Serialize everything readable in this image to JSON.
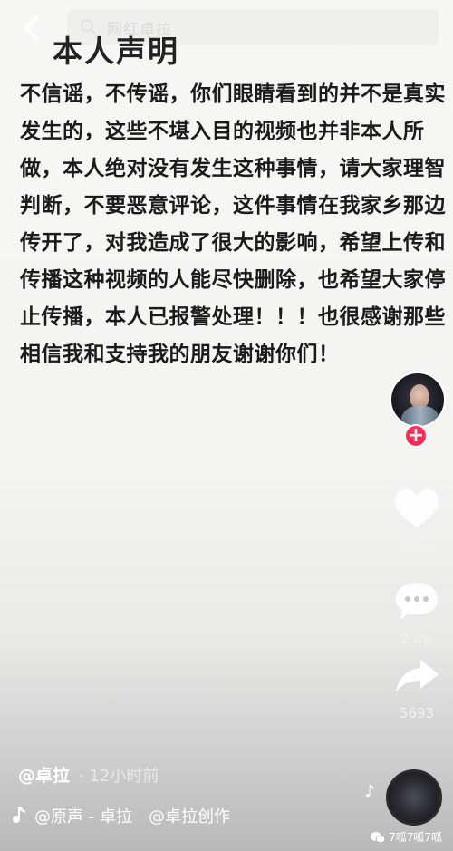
{
  "header": {
    "search_placeholder": "网红卓拉",
    "title": "本人声明"
  },
  "statement": {
    "text": "不信谣，不传谣，你们眼睛看到的并不是真实发生的，这些不堪入目的视频也并非本人所做，本人绝对没有发生这种事情，请大家理智判断，不要恶意评论，这件事情在我家乡那边传开了，对我造成了很大的影响，希望上传和传播这种视频的人能尽快删除，也希望大家停止传播，本人已报警处理！！！也很感谢那些相信我和支持我的朋友谢谢你们！"
  },
  "actions": {
    "like_count": "2.4w",
    "comment_count": "2.0w",
    "share_count": "5693"
  },
  "footer": {
    "author": "@卓拉",
    "time": "· 12小时前",
    "sound": "@原声 - 卓拉",
    "mention": "@卓拉创作"
  },
  "watermark": {
    "text": "7呱7呱7呱"
  },
  "colors": {
    "accent": "#fe2c55",
    "text": "#1b1b1b"
  },
  "icons": [
    "back-icon",
    "search-icon",
    "heart-icon",
    "comment-icon",
    "share-icon",
    "music-note-icon",
    "wechat-icon"
  ]
}
